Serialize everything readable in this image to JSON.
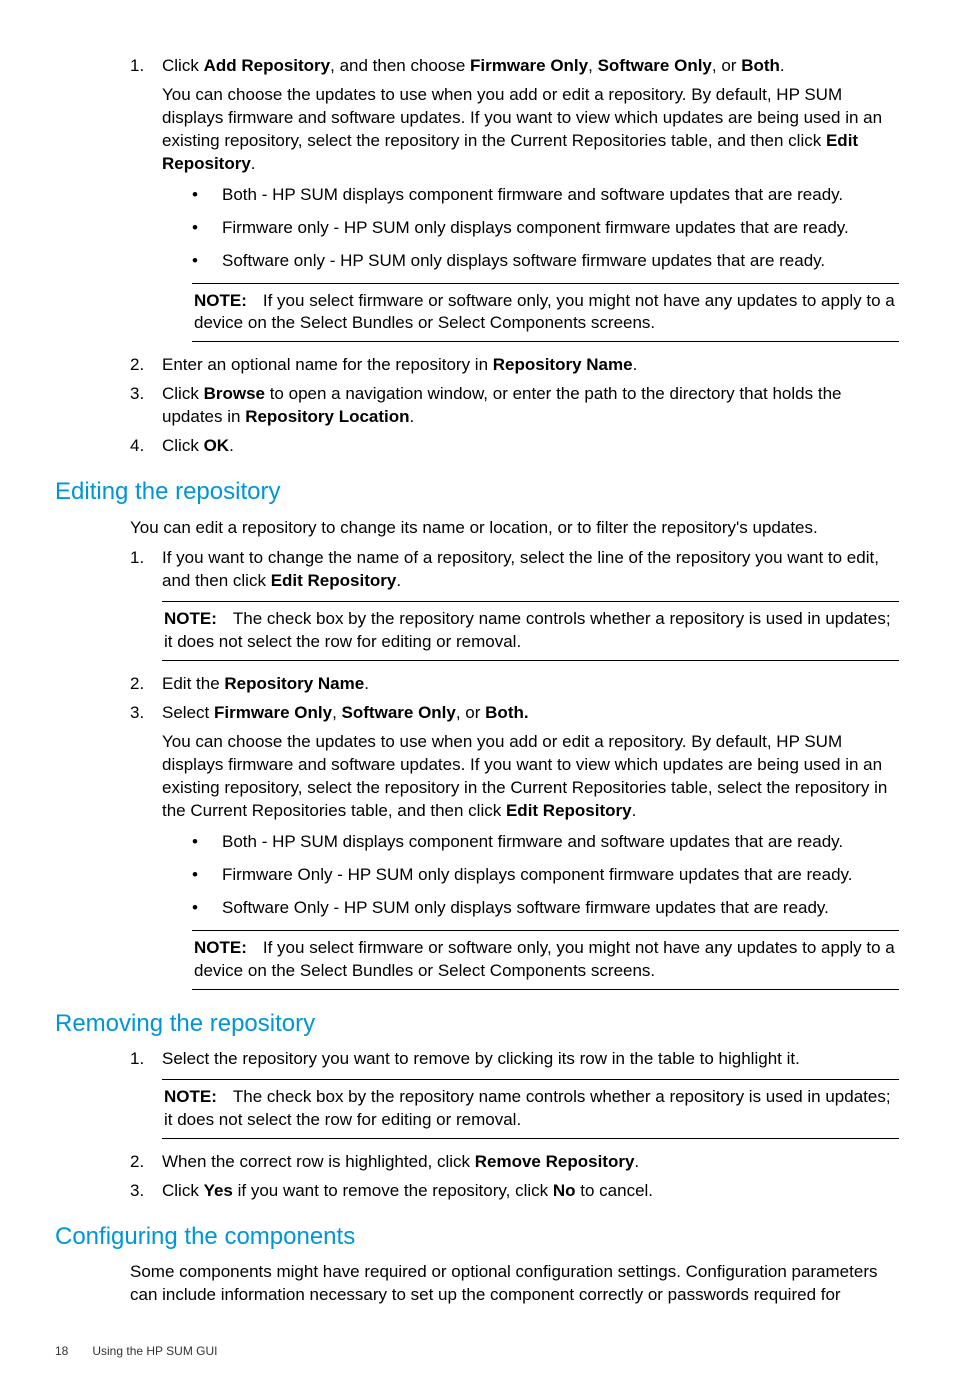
{
  "sectionA": {
    "step1_a": "Click ",
    "step1_b1": "Add Repository",
    "step1_c": ", and then choose ",
    "step1_b2": "Firmware Only",
    "step1_d": ", ",
    "step1_b3": "Software Only",
    "step1_e": ", or ",
    "step1_b4": "Both",
    "step1_f": ".",
    "step1_desc1": "You can choose the updates to use when you add or edit a repository. By default, HP SUM displays firmware and software updates. If you want to view which updates are being used in an existing repository, select the repository in the Current Repositories table, and then click ",
    "step1_desc_b": "Edit Repository",
    "step1_desc2": ".",
    "bullet1": "Both - HP SUM displays component firmware and software updates that are ready.",
    "bullet2": "Firmware only - HP SUM only displays component firmware updates that are ready.",
    "bullet3": "Software only - HP SUM only displays software firmware updates that are ready.",
    "note_label": "NOTE:",
    "note_text": "If you select firmware or software only, you might not have any updates to apply to a device on the Select Bundles or Select Components screens.",
    "step2_a": "Enter an optional name for the repository in ",
    "step2_b": "Repository Name",
    "step2_c": ".",
    "step3_a": "Click ",
    "step3_b1": "Browse",
    "step3_c": " to open a navigation window, or enter the path to the directory that holds the updates in ",
    "step3_b2": "Repository Location",
    "step3_d": ".",
    "step4_a": "Click ",
    "step4_b": "OK",
    "step4_c": "."
  },
  "editing": {
    "heading": "Editing the repository",
    "intro": "You can edit a repository to change its name or location, or to filter the repository's updates.",
    "step1_a": "If you want to change the name of a repository, select the line of the repository you want to edit, and then click ",
    "step1_b": "Edit Repository",
    "step1_c": ".",
    "note1_label": "NOTE:",
    "note1_text": "The check box by the repository name controls whether a repository is used in updates; it does not select the row for editing or removal.",
    "step2_a": "Edit the ",
    "step2_b": "Repository Name",
    "step2_c": ".",
    "step3_a": "Select ",
    "step3_b1": "Firmware Only",
    "step3_c": ", ",
    "step3_b2": "Software Only",
    "step3_d": ", or ",
    "step3_b3": "Both.",
    "step3_desc1": "You can choose the updates to use when you add or edit a repository. By default, HP SUM displays firmware and software updates. If you want to view which updates are being used in an existing repository, select the repository in the Current Repositories table, select the repository in the Current Repositories table, and then click ",
    "step3_desc_b": "Edit Repository",
    "step3_desc2": ".",
    "bullet1": "Both - HP SUM displays component firmware and software updates that are ready.",
    "bullet2": "Firmware Only - HP SUM only displays component firmware updates that are ready.",
    "bullet3": "Software Only - HP SUM only displays software firmware updates that are ready.",
    "note2_label": "NOTE:",
    "note2_text": "If you select firmware or software only, you might not have any updates to apply to a device on the Select Bundles or Select Components screens."
  },
  "removing": {
    "heading": "Removing the repository",
    "step1": "Select the repository you want to remove by clicking its row in the table to highlight it.",
    "note_label": "NOTE:",
    "note_text": "The check box by the repository name controls whether a repository is used in updates; it does not select the row for editing or removal.",
    "step2_a": "When the correct row is highlighted, click ",
    "step2_b": "Remove Repository",
    "step2_c": ".",
    "step3_a": "Click ",
    "step3_b1": "Yes",
    "step3_c": " if you want to remove the repository, click ",
    "step3_b2": "No",
    "step3_d": " to cancel."
  },
  "configuring": {
    "heading": "Configuring the components",
    "text": "Some components might have required or optional configuration settings. Configuration parameters can include information necessary to set up the component correctly or passwords required for"
  },
  "footer": {
    "page": "18",
    "title": "Using the HP SUM GUI"
  }
}
